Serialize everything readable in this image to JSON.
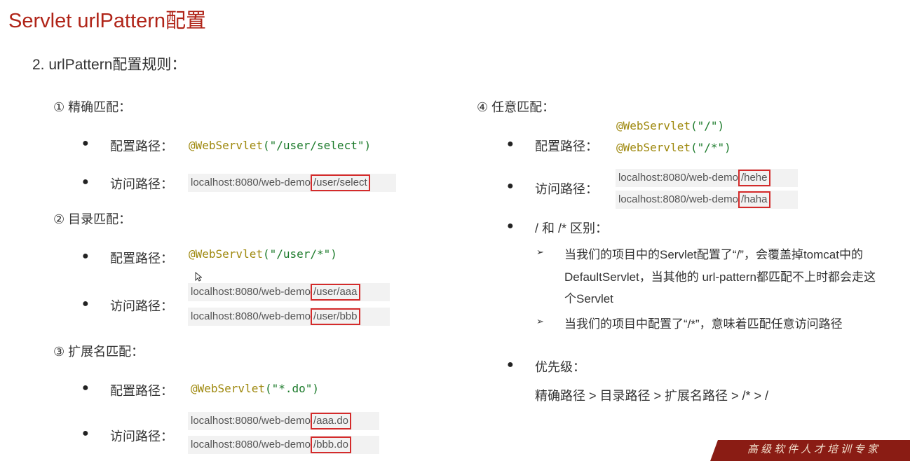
{
  "title": "Servlet urlPattern配置",
  "heading": "2. urlPattern配置规则：",
  "labels": {
    "config": "配置路径：",
    "access": "访问路径："
  },
  "sections": {
    "exact": {
      "title": "① 精确匹配：",
      "config_ann": "@WebServlet",
      "config_args": "(\"/user/select\")",
      "url_prefix": "localhost:8080/web-demo",
      "url_suffix": "/user/select"
    },
    "directory": {
      "title": "② 目录匹配：",
      "config_ann": "@WebServlet",
      "config_args": "(\"/user/*\")",
      "url1_prefix": "localhost:8080/web-demo",
      "url1_suffix": "/user/aaa",
      "url2_prefix": "localhost:8080/web-demo",
      "url2_suffix": "/user/bbb"
    },
    "extension": {
      "title": "③ 扩展名匹配：",
      "config_ann": "@WebServlet",
      "config_args": "(\"*.do\")",
      "url1_prefix": "localhost:8080/web-demo",
      "url1_suffix": "/aaa.do",
      "url2_prefix": "localhost:8080/web-demo",
      "url2_suffix": "/bbb.do"
    },
    "any": {
      "title": "④ 任意匹配：",
      "config1_ann": "@WebServlet",
      "config1_args": "(\"/\")",
      "config2_ann": "@WebServlet",
      "config2_args": "(\"/*\")",
      "url1_prefix": "localhost:8080/web-demo",
      "url1_suffix": "/hehe",
      "url2_prefix": "localhost:8080/web-demo",
      "url2_suffix": "/haha"
    }
  },
  "difference": {
    "title": "/ 和 /* 区别：",
    "item1_line1": "当我们的项目中的Servlet配置了“/”，会覆盖掉tomcat中的",
    "item1_line2": "DefaultServlet，当其他的 url-pattern都匹配不上时都会走这",
    "item1_line3": "个Servlet",
    "item2": "当我们的项目中配置了“/*”，意味着匹配任意访问路径"
  },
  "priority": {
    "title": "优先级：",
    "value": "精确路径 > 目录路径 > 扩展名路径 > /* > /"
  },
  "footer": "高级软件人才培训专家",
  "colors": {
    "title": "#b02418",
    "highlight_box": "#d42b2b",
    "footer_bg": "#8a1c14"
  }
}
